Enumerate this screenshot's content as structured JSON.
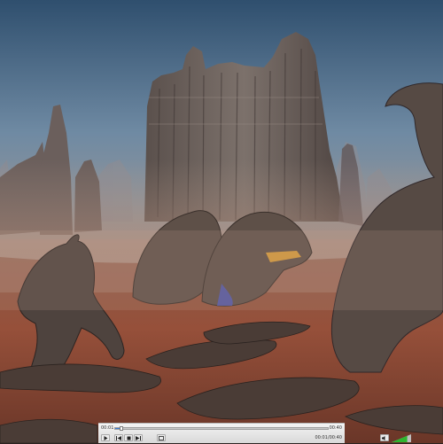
{
  "scene": {
    "description_icon": "scene-image"
  },
  "player": {
    "elapsed": "00:01",
    "total": "00:40",
    "timecode": "00:01/00:40",
    "progress": 0.03,
    "volume": 0.8,
    "icons": {
      "play": "play-icon",
      "prev": "previous-icon",
      "stop": "stop-icon",
      "next": "next-icon",
      "fullscreen": "fullscreen-icon",
      "mute": "speaker-icon"
    },
    "accent": "#3a7bd5",
    "volume_color": "#2fb52f"
  }
}
